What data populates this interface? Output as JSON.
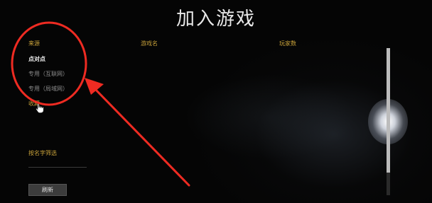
{
  "window": {
    "title": "加入游戏"
  },
  "columns": {
    "source": "来源",
    "game_name": "游戏名",
    "player_count": "玩家数"
  },
  "sources": [
    {
      "label": "点对点",
      "state": "selected"
    },
    {
      "label": "专用（互联网）",
      "state": "unselected"
    },
    {
      "label": "专用（局域网）",
      "state": "unselected"
    },
    {
      "label": "收藏",
      "state": "hovered"
    }
  ],
  "filter": {
    "label": "按名字筛选",
    "value": ""
  },
  "refresh_button": {
    "label": "刷新"
  },
  "annotation": {
    "color": "#ee2b22"
  },
  "colors": {
    "accent": "#c9a23a",
    "title": "#e8e8e8",
    "background": "#050505"
  }
}
